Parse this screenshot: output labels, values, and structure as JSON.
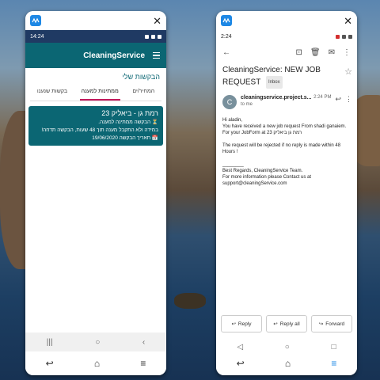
{
  "left": {
    "time": "14:24",
    "app_title": "CleaningService",
    "section_title": "הבקשות שלי",
    "tabs": [
      "בקשות שנענו",
      "ממתינות למענה",
      "המחיר/ים"
    ],
    "card": {
      "title": "רמת גן - ביאליק 23",
      "line1": "הבקשה ממתינה למענה.",
      "line2": "במידה ולא התקבל מענה תוך 48 שעות, הבקשה תדחה!",
      "date": "תאריך הבקשה 19/06/2020"
    }
  },
  "right": {
    "time": "2:24",
    "subject": "CleaningService: NEW JOB REQUEST",
    "label": "Inbox",
    "sender": "cleaningservice.project.s...",
    "sent_time": "2:24 PM",
    "to": "to me",
    "body": [
      "Hi aladin,",
      "You have received a new job request From shadi ganaiem.",
      "For your JobForm at רמת גן ביאליק 23",
      "",
      "The request will be rejected if no reply is made within 48 Hours !",
      "",
      "________",
      "Best Regards, CleaningService Team.",
      "For more information please Contact us at",
      "support@cleaningService.com"
    ],
    "buttons": {
      "reply": "Reply",
      "reply_all": "Reply all",
      "forward": "Forward"
    }
  },
  "colors": {
    "teal": "#0b6673",
    "accent": "#c2185b",
    "brand": "#1e88e5"
  }
}
